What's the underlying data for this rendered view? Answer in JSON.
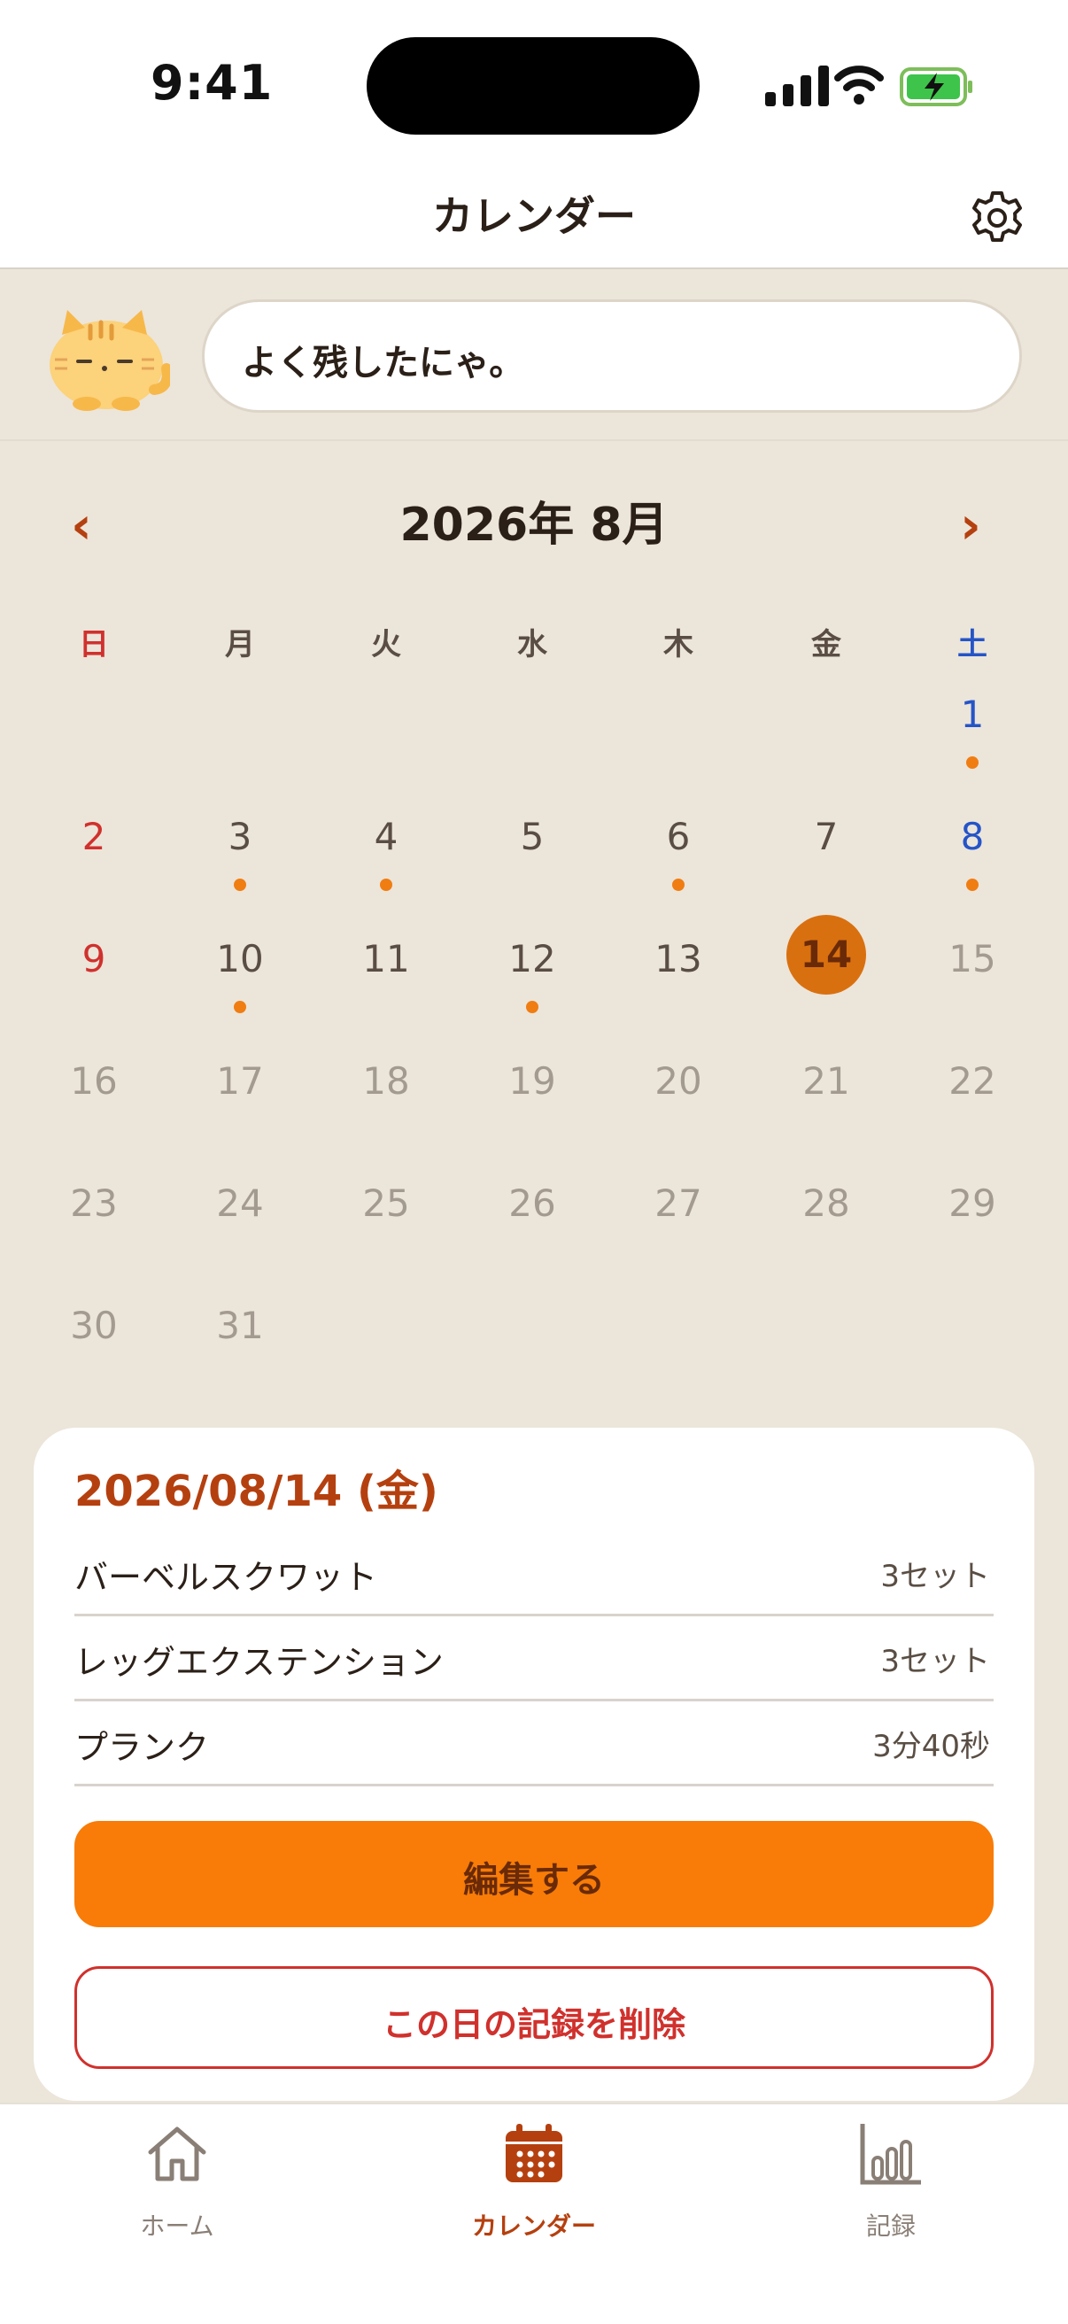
{
  "status": {
    "time": "9:41"
  },
  "header": {
    "title": "カレンダー",
    "settings_icon": "gear-icon"
  },
  "message": {
    "text": "よく残したにゃ。",
    "avatar_icon": "cat-avatar"
  },
  "calendar": {
    "month_label": "2026年 8月",
    "prev_icon": "chevron-left-icon",
    "next_icon": "chevron-right-icon",
    "weekdays": [
      "日",
      "月",
      "火",
      "水",
      "木",
      "金",
      "土"
    ],
    "first_weekday_index": 6,
    "days_in_month": 31,
    "today": 14,
    "selected": 14,
    "days_with_records": [
      1,
      3,
      4,
      6,
      8,
      10,
      12
    ],
    "colors": {
      "sunday": "#d0312d",
      "saturday": "#2554c7",
      "past": "#5a4e44",
      "future": "#a39a90",
      "selected_bg": "#d9700f",
      "selected_text": "#6a2a08",
      "dot": "#f07d12"
    }
  },
  "detail": {
    "date_title": "2026/08/14 (金)",
    "entries": [
      {
        "name": "バーベルスクワット",
        "value": "3セット"
      },
      {
        "name": "レッグエクステンション",
        "value": "3セット"
      },
      {
        "name": "プランク",
        "value": "3分40秒"
      }
    ],
    "edit_label": "編集する",
    "delete_label": "この日の記録を削除"
  },
  "tabs": [
    {
      "label": "ホーム",
      "icon": "home-icon",
      "active": false
    },
    {
      "label": "カレンダー",
      "icon": "calendar-icon",
      "active": true
    },
    {
      "label": "記録",
      "icon": "bar-chart-icon",
      "active": false
    }
  ]
}
